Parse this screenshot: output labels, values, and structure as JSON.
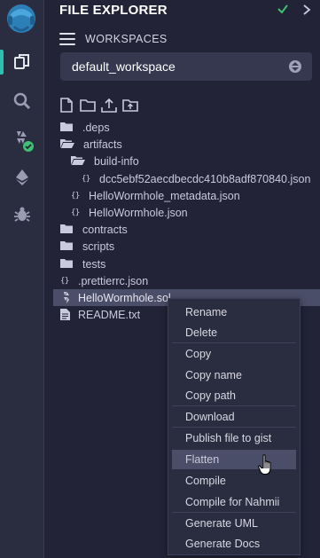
{
  "header": {
    "title": "FILE EXPLORER",
    "workspaces_label": "WORKSPACES",
    "workspace_selected": "default_workspace"
  },
  "activity_bar": {
    "items": [
      "file-explorer-icon",
      "search-icon",
      "solidity-compiler-icon",
      "deploy-run-icon",
      "debugger-icon"
    ]
  },
  "tree": {
    "items": [
      {
        "label": ".deps",
        "type": "folder"
      },
      {
        "label": "artifacts",
        "type": "folder-open"
      },
      {
        "label": "build-info",
        "type": "folder-open"
      },
      {
        "label": "dcc5ebf52aecdbecdc410b8adf870840.json",
        "type": "json"
      },
      {
        "label": "HelloWormhole_metadata.json",
        "type": "json"
      },
      {
        "label": "HelloWormhole.json",
        "type": "json"
      },
      {
        "label": "contracts",
        "type": "folder"
      },
      {
        "label": "scripts",
        "type": "folder"
      },
      {
        "label": "tests",
        "type": "folder"
      },
      {
        "label": ".prettierrc.json",
        "type": "json"
      },
      {
        "label": "HelloWormhole.sol",
        "type": "sol"
      },
      {
        "label": "README.txt",
        "type": "file"
      }
    ]
  },
  "context_menu": {
    "items": [
      "Rename",
      "Delete",
      "Copy",
      "Copy name",
      "Copy path",
      "Download",
      "Publish file to gist",
      "Flatten",
      "Compile",
      "Compile for Nahmii",
      "Generate UML",
      "Generate Docs"
    ],
    "hovered": "Flatten"
  },
  "colors": {
    "background": "#222336",
    "accent": "#2fbfb1",
    "check": "#3fbf73"
  }
}
